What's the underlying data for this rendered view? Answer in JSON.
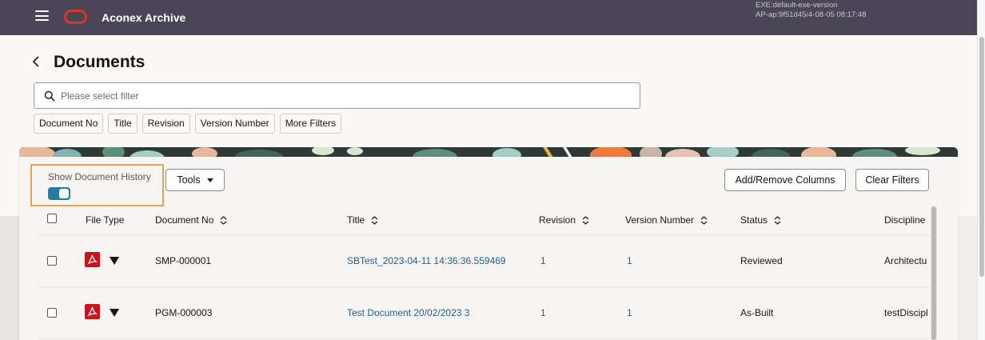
{
  "app": {
    "title": "Aconex Archive",
    "version_line1": "EXE:default-exe-version",
    "version_line2": "AP-ap:9f51d45/4-08-05 08:17:48"
  },
  "page": {
    "title": "Documents",
    "search_placeholder": "Please select filter"
  },
  "filter_chips": [
    "Document No",
    "Title",
    "Revision",
    "Version Number",
    "More Filters"
  ],
  "toolbar": {
    "history_label": "Show Document History",
    "history_enabled": true,
    "tools_label": "Tools",
    "add_remove_label": "Add/Remove Columns",
    "clear_filters_label": "Clear Filters"
  },
  "table": {
    "columns": [
      "File Type",
      "Document No",
      "Title",
      "Revision",
      "Version Number",
      "Status",
      "Discipline"
    ],
    "rows": [
      {
        "file_type": "pdf-icon",
        "document_no": "SMP-000001",
        "title": "SBTest_2023-04-11 14:36:36.559469",
        "revision": "1",
        "version": "1",
        "status": "Reviewed",
        "discipline": "Architectu"
      },
      {
        "file_type": "pdf-icon",
        "document_no": "PGM-000003",
        "title": "Test Document 20/02/2023 3",
        "revision": "1",
        "version": "1",
        "status": "As-Built",
        "discipline": "testDiscipl"
      }
    ]
  },
  "colors": {
    "topbar": "#4a4658",
    "accent": "#227e9e",
    "highlight": "#e2a452",
    "link": "#1f5f84",
    "pdf": "#c8141a"
  }
}
